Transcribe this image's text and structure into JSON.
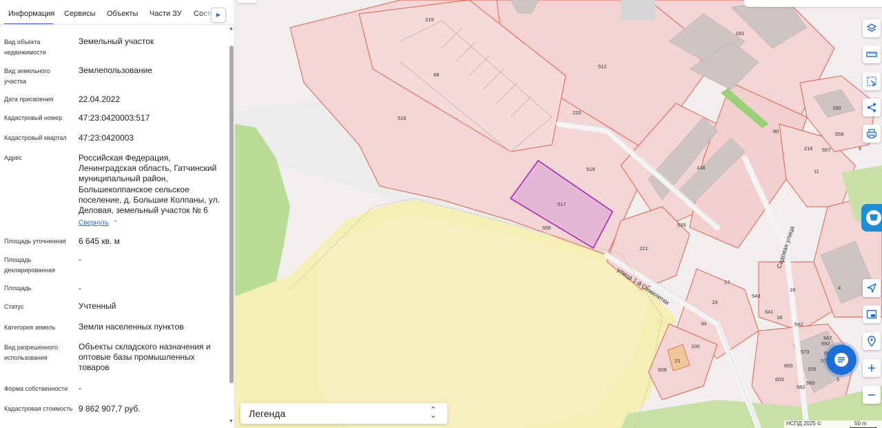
{
  "tabs": [
    {
      "label": "Информация",
      "active": true
    },
    {
      "label": "Сервисы",
      "active": false
    },
    {
      "label": "Объекты",
      "active": false
    },
    {
      "label": "Части ЗУ",
      "active": false
    },
    {
      "label": "Соста",
      "active": false
    }
  ],
  "info": {
    "object_type": {
      "label": "Вид объекта недвижимости",
      "value": "Земельный участок"
    },
    "land_type": {
      "label": "Вид земельного участка",
      "value": "Землепользование"
    },
    "assign_date": {
      "label": "Дата присвоения",
      "value": "22.04.2022"
    },
    "cadastral_number": {
      "label": "Кадастровый номер",
      "value": "47:23:0420003:517"
    },
    "cadastral_quarter": {
      "label": "Кадастровый квартал",
      "value": "47:23:0420003"
    },
    "address": {
      "label": "Адрес",
      "value": "Российская Федерация, Ленинградская область, Гатчинский муниципальный район, Большеколпанское сельское поселение, д. Большие Колпаны, ул. Деловая, земельный участок № 6"
    },
    "collapse_link": "Свернуть",
    "area_refined": {
      "label": "Площадь уточненная",
      "value": "6 645 кв. м"
    },
    "area_declared": {
      "label": "Площадь декларированная",
      "value": "-"
    },
    "area": {
      "label": "Площадь",
      "value": "-"
    },
    "status": {
      "label": "Статус",
      "value": "Учтенный"
    },
    "land_category": {
      "label": "Категория земель",
      "value": "Земли населенных пунктов"
    },
    "permitted_use": {
      "label": "Вид разрешенного использования",
      "value": "Объекты складского назначения и оптовые базы промышленных товаров"
    },
    "ownership": {
      "label": "Форма собственности",
      "value": "-"
    },
    "cadastral_value": {
      "label": "Кадастровая стоимость",
      "value": "9 862 907,7 руб."
    }
  },
  "map": {
    "plot_labels": [
      "219",
      "193",
      "512",
      "68",
      "220",
      "516",
      "518",
      "517",
      "556",
      "148",
      "535",
      "221",
      "80",
      "160",
      "558",
      "557",
      "216",
      "11",
      "6",
      "4",
      "17",
      "543",
      "16",
      "19",
      "541",
      "18",
      "542",
      "34",
      "100",
      "573",
      "567",
      "592",
      "568",
      "570",
      "600",
      "105",
      "603",
      "560",
      "582",
      "508",
      "21",
      "5"
    ],
    "streets": [
      "улица 1-й Семилетки",
      "Садовая улица"
    ],
    "legend_label": "Легенда",
    "copyright": "НСПД 2025 ©",
    "scale_label": "50 m",
    "selected_color": "#a020b0",
    "boundary_color": "#e0604a"
  }
}
